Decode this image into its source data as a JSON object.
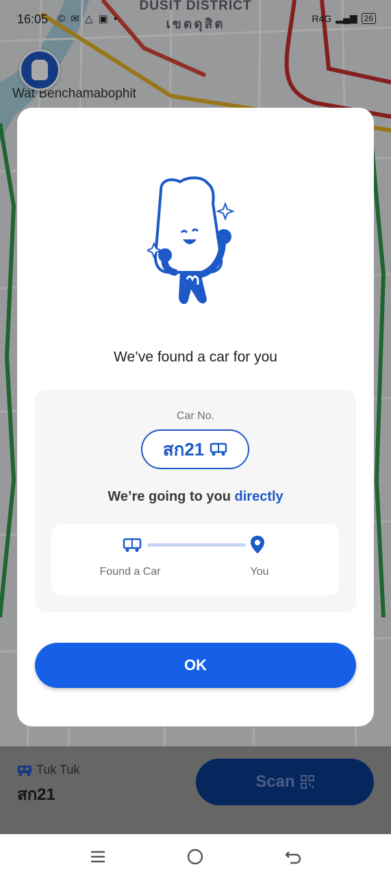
{
  "status_bar": {
    "time": "16:05",
    "network": "R4G",
    "battery": "26"
  },
  "map": {
    "district_en": "DUSIT DISTRICT",
    "district_th": "เขตดุสิต",
    "landmark": "Wat Benchamabophit"
  },
  "modal": {
    "title": "We’ve found a car for you",
    "car_no_label": "Car No.",
    "car_plate": "สก21",
    "going_text": "We’re going to you",
    "going_highlight": "directly",
    "progress": {
      "from_label": "Found a Car",
      "to_label": "You"
    },
    "ok_label": "OK"
  },
  "sheet": {
    "vehicle_type": "Tuk Tuk",
    "vehicle_plate": "สก21",
    "scan_label": "Scan"
  },
  "colors": {
    "brand_blue": "#1d59c7",
    "ok_button": "#1560e6",
    "scan_button": "#0a3a8f"
  },
  "icons": {
    "car": "tuk-tuk-icon",
    "pin": "location-pin-icon",
    "qr": "qr-code-icon",
    "nav_menu": "menu-icon",
    "nav_home": "home-icon",
    "nav_back": "back-icon"
  }
}
